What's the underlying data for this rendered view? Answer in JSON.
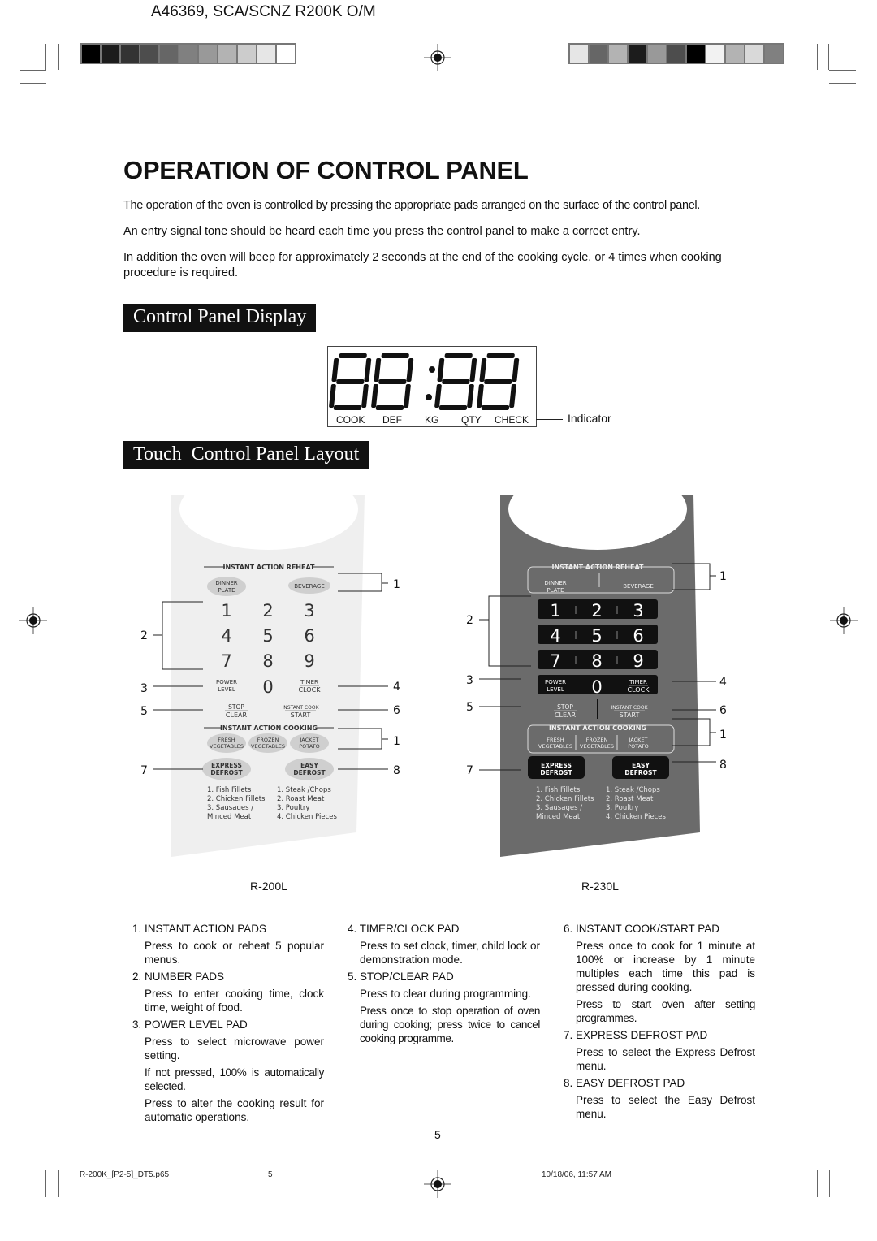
{
  "header": {
    "doc_code": "A46369, SCA/SCNZ R200K O/M",
    "left_swatches": [
      "#000000",
      "#1c1c1c",
      "#333333",
      "#4d4d4d",
      "#666666",
      "#808080",
      "#999999",
      "#b3b3b3",
      "#cccccc",
      "#e6e6e6",
      "#ffffff"
    ],
    "right_swatches": [
      "#e6e6e6",
      "#666666",
      "#b3b3b3",
      "#1c1c1c",
      "#999999",
      "#4d4d4d",
      "#000000",
      "#f2f2f2",
      "#b3b3b3",
      "#d9d9d9",
      "#808080"
    ]
  },
  "page": {
    "title": "OPERATION OF CONTROL PANEL",
    "intro": [
      "The operation of the oven is controlled by pressing the appropriate pads arranged on the surface of the control panel.",
      "An entry signal tone should be heard each time you press the control panel to make a correct entry.",
      "In addition the oven will beep for approximately 2 seconds at the end of the cooking cycle, or 4 times when cooking procedure is required."
    ]
  },
  "display_section": {
    "heading": "Control Panel Display",
    "digits": "88:88",
    "indicators": [
      "COOK",
      "DEF",
      "KG",
      "QTY",
      "CHECK"
    ],
    "indicator_callout": "Indicator"
  },
  "layout_section": {
    "heading": "Touch  Control Panel Layout",
    "panels": [
      {
        "model": "R-200L",
        "reheat_title": "INSTANT ACTION REHEAT",
        "reheat_pads": [
          "DINNER PLATE",
          "BEVERAGE"
        ],
        "number_pads": [
          "1",
          "2",
          "3",
          "4",
          "5",
          "6",
          "7",
          "8",
          "9",
          "0"
        ],
        "power_level": [
          "POWER",
          "LEVEL"
        ],
        "timer_clock": [
          "TIMER",
          "CLOCK"
        ],
        "stop_clear": [
          "STOP",
          "CLEAR"
        ],
        "instant_start": [
          "INSTANT COOK",
          "START"
        ],
        "cooking_title": "INSTANT ACTION COOKING",
        "cooking_pads": [
          [
            "FRESH",
            "VEGETABLES"
          ],
          [
            "FROZEN",
            "VEGETABLES"
          ],
          [
            "JACKET",
            "POTATO"
          ]
        ],
        "express_defrost": [
          "EXPRESS",
          "DEFROST"
        ],
        "easy_defrost": [
          "EASY",
          "DEFROST"
        ],
        "express_list": [
          "1. Fish Fillets",
          "2. Chicken Fillets",
          "3. Sausages /",
          "   Minced Meat"
        ],
        "easy_list": [
          "1. Steak /Chops",
          "2. Roast Meat",
          "3. Poultry",
          "4. Chicken Pieces"
        ],
        "callouts": [
          "1",
          "2",
          "3",
          "4",
          "5",
          "6",
          "1",
          "7",
          "8"
        ]
      },
      {
        "model": "R-230L",
        "reheat_title": "INSTANT ACTION REHEAT",
        "reheat_pads": [
          "DINNER PLATE",
          "BEVERAGE"
        ],
        "number_pads": [
          "1",
          "2",
          "3",
          "4",
          "5",
          "6",
          "7",
          "8",
          "9",
          "0"
        ],
        "power_level": [
          "POWER",
          "LEVEL"
        ],
        "timer_clock": [
          "TIMER",
          "CLOCK"
        ],
        "stop_clear": [
          "STOP",
          "CLEAR"
        ],
        "instant_start": [
          "INSTANT COOK",
          "START"
        ],
        "cooking_title": "INSTANT ACTION COOKING",
        "cooking_pads": [
          [
            "FRESH",
            "VEGETABLES"
          ],
          [
            "FROZEN",
            "VEGETABLES"
          ],
          [
            "JACKET",
            "POTATO"
          ]
        ],
        "express_defrost": [
          "EXPRESS",
          "DEFROST"
        ],
        "easy_defrost": [
          "EASY",
          "DEFROST"
        ],
        "express_list": [
          "1. Fish Fillets",
          "2. Chicken Fillets",
          "3. Sausages /",
          "   Minced Meat"
        ],
        "easy_list": [
          "1. Steak /Chops",
          "2. Roast Meat",
          "3. Poultry",
          "4. Chicken Pieces"
        ],
        "callouts": [
          "1",
          "2",
          "3",
          "4",
          "5",
          "6",
          "1",
          "7",
          "8"
        ]
      }
    ]
  },
  "descriptions": [
    {
      "heading": "1. INSTANT ACTION PADS",
      "body": [
        "Press to cook or reheat 5 popular menus."
      ]
    },
    {
      "heading": "2. NUMBER PADS",
      "body": [
        "Press to enter cooking time, clock time, weight of food."
      ]
    },
    {
      "heading": "3. POWER LEVEL PAD",
      "body": [
        "Press to select microwave power setting.",
        "If not pressed, 100% is automatically selected.",
        "Press to alter the cooking result for automatic operations."
      ]
    },
    {
      "heading": "4. TIMER/CLOCK PAD",
      "body": [
        "Press to set clock, timer, child lock or demonstration mode."
      ]
    },
    {
      "heading": "5. STOP/CLEAR PAD",
      "body": [
        "Press to clear during programming.",
        "Press once to stop operation of oven during cooking; press twice to cancel cooking programme."
      ]
    },
    {
      "heading": "6. INSTANT COOK/START PAD",
      "body": [
        "Press once to cook for 1 minute at 100% or increase by 1 minute multiples each time this pad is pressed during cooking.",
        "Press to start oven after setting programmes."
      ]
    },
    {
      "heading": "7. EXPRESS DEFROST PAD",
      "body": [
        "Press to select the Express Defrost menu."
      ]
    },
    {
      "heading": "8. EASY DEFROST PAD",
      "body": [
        "Press to select the Easy Defrost menu."
      ]
    }
  ],
  "page_number": "5",
  "footer": {
    "file": "R-200K_[P2-5]_DT5.p65",
    "page": "5",
    "timestamp": "10/18/06, 11:57 AM"
  }
}
